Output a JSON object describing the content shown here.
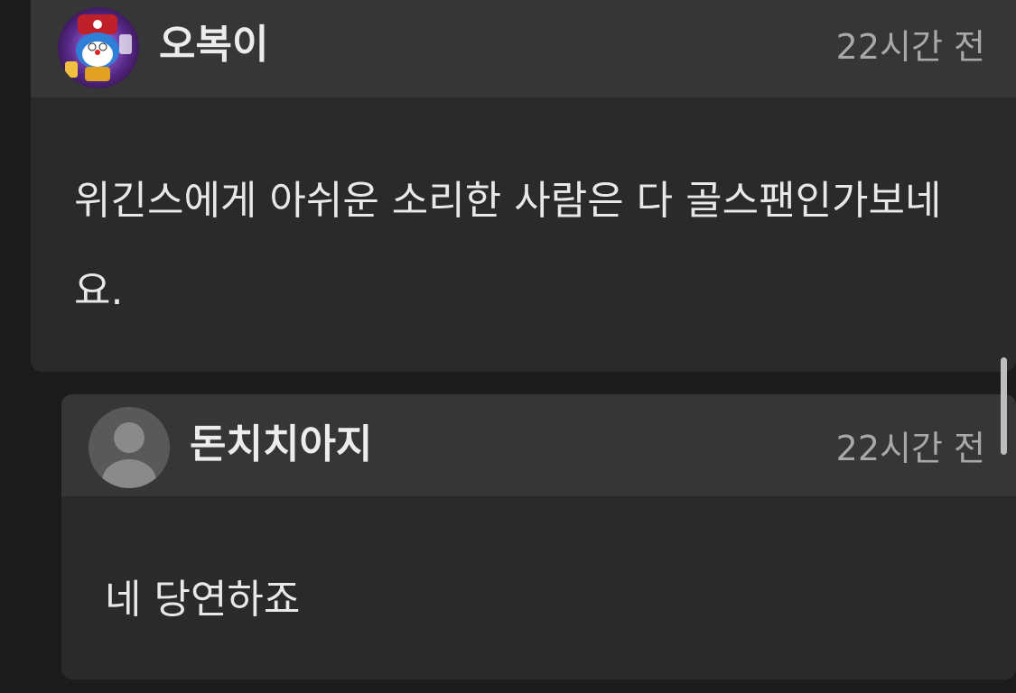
{
  "comments": [
    {
      "username": "오복이",
      "timestamp": "22시간 전",
      "body": "위긴스에게 아쉬운 소리한 사람은 다 골스팬인가보네요.",
      "avatar": "character-avatar"
    },
    {
      "username": "돈치치아지",
      "timestamp": "22시간 전",
      "body": "네 당연하죠",
      "avatar": "default-user-avatar"
    }
  ],
  "colors": {
    "background": "#1c1c1c",
    "card": "#2a2a2a",
    "card_header": "#363636",
    "text": "#e8e8e8",
    "muted_text": "#a8a8a8"
  }
}
